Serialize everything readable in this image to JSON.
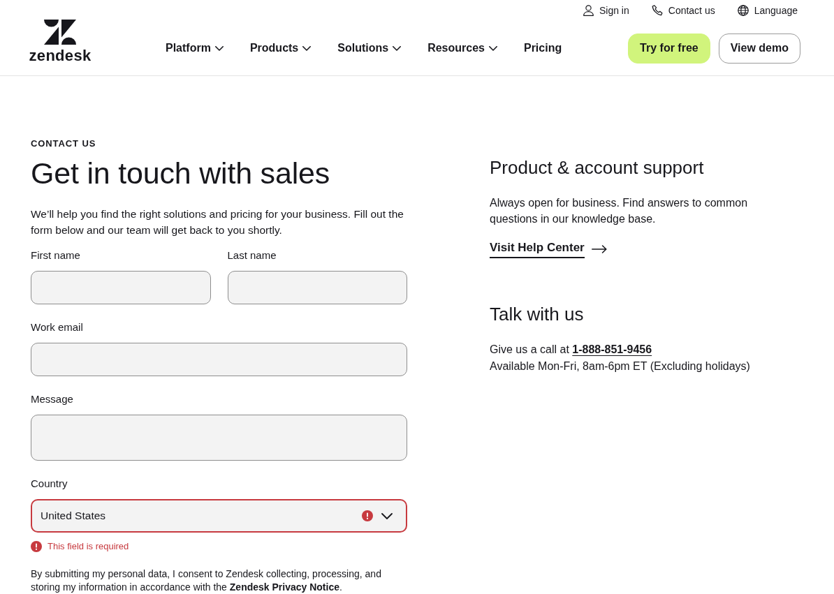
{
  "header": {
    "utility_links": [
      {
        "kind": "user",
        "label": "Sign in"
      },
      {
        "kind": "phone",
        "label": "Contact us"
      },
      {
        "kind": "globe",
        "label": "Language"
      }
    ],
    "logo": {
      "wordmark": "zendesk"
    },
    "nav": [
      {
        "label": "Platform",
        "has_menu": true
      },
      {
        "label": "Products",
        "has_menu": true
      },
      {
        "label": "Solutions",
        "has_menu": true
      },
      {
        "label": "Resources",
        "has_menu": true
      },
      {
        "label": "Pricing",
        "has_menu": false
      }
    ],
    "buttons": [
      {
        "label": "Try for free",
        "kind": "primary"
      },
      {
        "label": "View demo",
        "kind": "outline"
      }
    ]
  },
  "sales_form": {
    "eyebrow": "CONTACT US",
    "title": "Get in touch with sales",
    "intro": "We’ll help you find the right solutions and pricing for your business. Fill out the form below and our team will get back to you shortly.",
    "field_rows": [
      {
        "fields": [
          {
            "label": "First name",
            "kind": "text",
            "invalid": false
          },
          {
            "label": "Last name",
            "kind": "text",
            "invalid": false
          }
        ]
      },
      {
        "fields": [
          {
            "label": "Work email",
            "kind": "email",
            "invalid": false
          }
        ]
      },
      {
        "fields": [
          {
            "label": "Message",
            "kind": "textarea",
            "invalid": false
          }
        ]
      },
      {
        "fields": [
          {
            "label": "Country",
            "kind": "select",
            "value": "United States",
            "invalid": true,
            "error": "This field is required"
          }
        ]
      }
    ],
    "consent": {
      "text": "By submitting my personal data, I consent to Zendesk collecting, processing, and storing my information in accordance with the",
      "link": "Zendesk Privacy Notice",
      "end": "."
    }
  },
  "product_support": {
    "title": "Product & account support",
    "text": "Always open for business. Find answers to common questions in our knowledge base.",
    "link": "Visit Help Center"
  },
  "talk_with_us": {
    "title": "Talk with us",
    "call_text": "Give us a call at",
    "phone": "1-888-851-9456",
    "hours": "Available Mon-Fri, 8am-6pm ET (Excluding holidays)"
  }
}
